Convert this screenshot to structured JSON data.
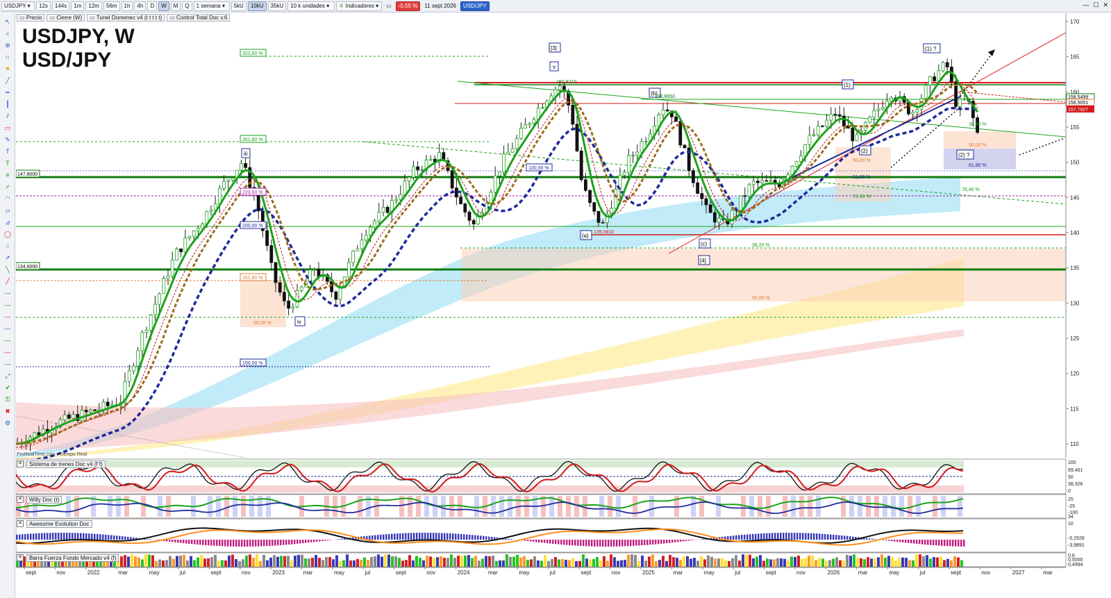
{
  "toolbar": {
    "symbol": "USDJPY",
    "intervals": [
      "12s",
      "144s",
      "1m",
      "12m",
      "56m",
      "1h",
      "4h",
      "D",
      "W",
      "M",
      "Q"
    ],
    "active_interval": "W",
    "period": "1 semana",
    "units": [
      "5kU",
      "10kU",
      "35kU"
    ],
    "active_unit": "10kU",
    "units_select": "10 k unidades",
    "indicators_label": "Indicadores",
    "change_pct": "-0,55 %",
    "date": "11 sept 2026",
    "ticker": "USD/JPY"
  },
  "legend": {
    "items": [
      "Precio",
      "Cierre (W)",
      "Tunel Domenec v4 (t t t t t)",
      "Control Total Doc v.6"
    ]
  },
  "chart_title": {
    "line1": "USDJPY, W",
    "line2": "USD/JPY"
  },
  "attribution": "ProRealTime.com - Tiempo Real",
  "panels": [
    {
      "name": "Sistema de trenes Doc v4 (f f)",
      "right_labels": [
        "100",
        "69,461",
        "50",
        "38,326",
        "0"
      ]
    },
    {
      "name": "Willy Doc (t)",
      "right_labels": [
        "25",
        "-25",
        "-100",
        "34"
      ]
    },
    {
      "name": "Awesome Evolution Doc",
      "right_labels": [
        "10",
        "-0,2928",
        "-3,9891"
      ]
    },
    {
      "name": "Barra Fuerza Fondo Mercado v4 (f)",
      "right_labels": [
        "0,6",
        "0,5000",
        "0,4994"
      ]
    }
  ],
  "price_axis": {
    "ticks": [
      "170",
      "165",
      "160",
      "155",
      "150",
      "145",
      "140",
      "135",
      "130",
      "125",
      "120",
      "115",
      "110"
    ],
    "current_labels": [
      "158,5499",
      "158,5051",
      "157,7927"
    ]
  },
  "time_axis": {
    "labels": [
      "sept",
      "nov",
      "2022",
      "mar",
      "may",
      "jul",
      "sept",
      "nov",
      "2023",
      "mar",
      "may",
      "jul",
      "sept",
      "nov",
      "2024",
      "mar",
      "may",
      "jul",
      "sept",
      "nov",
      "2025",
      "mar",
      "may",
      "jul",
      "sept",
      "nov",
      "2026",
      "mar",
      "may",
      "jul",
      "sept",
      "nov",
      "2027",
      "mar"
    ]
  },
  "levels": {
    "l147": "147,8000",
    "l134": "134,6000",
    "l139": "139,5810",
    "l161": "160,8210",
    "l158": "158,8650"
  },
  "fib_labels": {
    "f323": "323,60 %",
    "f261": "261,80 %",
    "f223": "223,60 %",
    "f200": "200,00 %",
    "f161": "161,80 %",
    "f50a": "50,00 %",
    "f100a": "100,00 %",
    "f100b": "100,00 %",
    "f382a": "38,20 %",
    "f50b": "50,00 %",
    "f50c": "50,00 %",
    "f618a": "61,80 %",
    "f764a": "76,40 %",
    "f382b": "38,20 %",
    "f50d": "50,00 %",
    "f618b": "61,80 %",
    "f764b": "76,40 %"
  },
  "wave_labels": {
    "w3": "[3]",
    "wv": "v",
    "wiii": "iii",
    "wiv": "iv",
    "wb": "(b)",
    "wa": "(a)",
    "wc": "(c)",
    "w4": "[4]",
    "w1": "(1)",
    "w2": "(2)",
    "w1q": "(1) ?",
    "w2q": "(2) ?"
  },
  "colors": {
    "green_line": "#1aa31a",
    "red_line": "#d21a1a",
    "blue_dash": "#1e2a9a",
    "brown_dash": "#9c6a1a",
    "dark_green_level": "#0d7a0d",
    "cyan_band": "#8fd8f0",
    "yellow_band": "#ffe98a",
    "pink_band": "#f5b8b8"
  }
}
